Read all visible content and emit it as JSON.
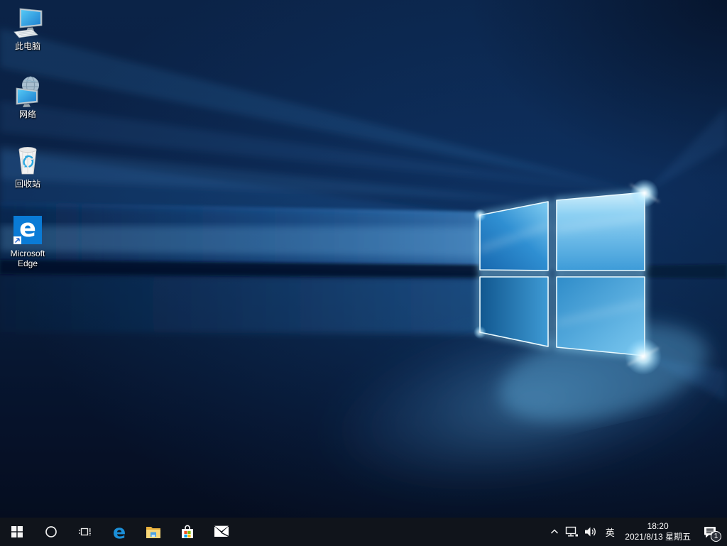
{
  "desktop": {
    "icons": [
      {
        "name": "this-pc",
        "label": "此电脑"
      },
      {
        "name": "network",
        "label": "网络"
      },
      {
        "name": "recycle-bin",
        "label": "回收站"
      },
      {
        "name": "microsoft-edge",
        "label": "Microsoft Edge"
      }
    ],
    "edge_glyph": "e"
  },
  "taskbar": {
    "edge_glyph": "e",
    "buttons": [
      {
        "name": "start"
      },
      {
        "name": "cortana-search"
      },
      {
        "name": "task-view"
      },
      {
        "name": "microsoft-edge"
      },
      {
        "name": "file-explorer"
      },
      {
        "name": "microsoft-store"
      },
      {
        "name": "mail"
      }
    ]
  },
  "tray": {
    "language_indicator": "英",
    "time": "18:20",
    "date": "2021/8/13 星期五",
    "notification_count": "1"
  },
  "colors": {
    "taskbar_bg": "#10141b",
    "edge_tile_blue": "#0a7bd6",
    "edge_e_blue": "#1b8fd8",
    "wallpaper_base": "#0a2044",
    "logo_bright_blue": "#7bc8f0",
    "store_red": "#f25022",
    "store_green": "#7fba00",
    "store_blue": "#00a4ef",
    "store_yellow": "#ffb900"
  }
}
